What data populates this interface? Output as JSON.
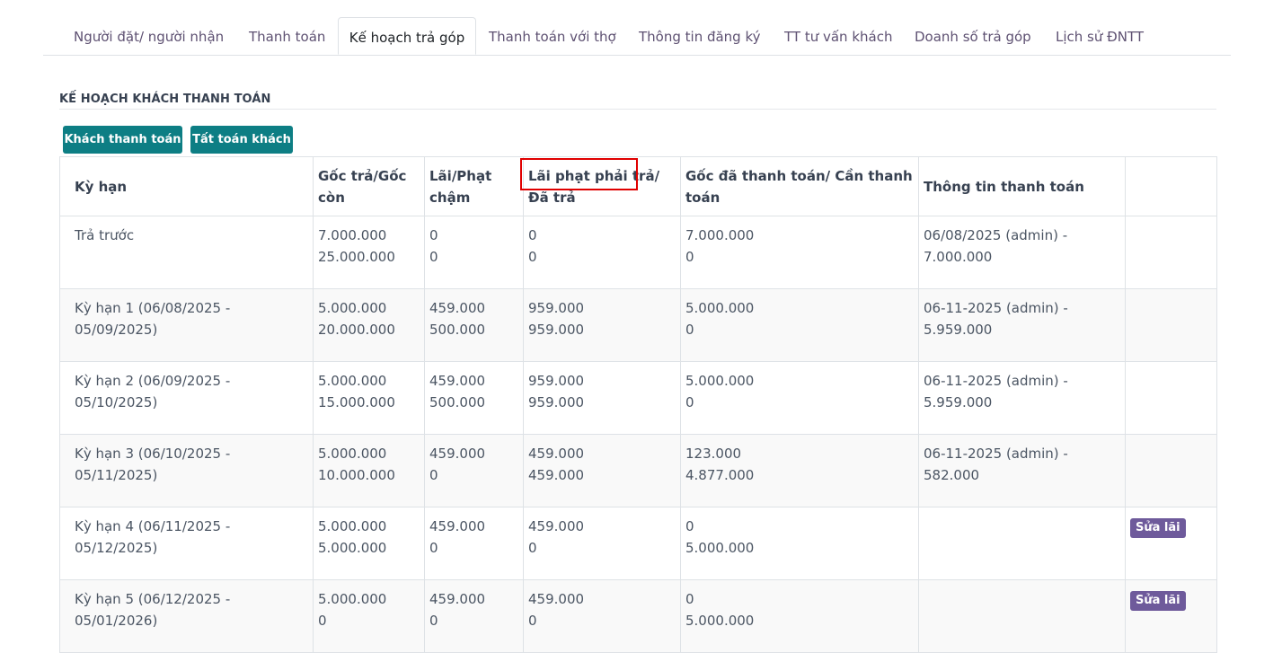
{
  "tabs": [
    {
      "label": "Người đặt/ người nhận",
      "active": false
    },
    {
      "label": "Thanh toán",
      "active": false
    },
    {
      "label": "Kế hoạch trả góp",
      "active": true
    },
    {
      "label": "Thanh toán với thợ",
      "active": false
    },
    {
      "label": "Thông tin đăng ký",
      "active": false
    },
    {
      "label": "TT tư vấn khách",
      "active": false
    },
    {
      "label": "Doanh số trả góp",
      "active": false
    },
    {
      "label": "Lịch sử ĐNTT",
      "active": false
    }
  ],
  "section": {
    "title": "KẾ HOẠCH KHÁCH THANH TOÁN"
  },
  "buttons": {
    "customer_payment": "Khách thanh toán",
    "settle_customer": "Tất toán khách"
  },
  "table": {
    "headers": {
      "term": "Kỳ hạn",
      "principal": "Gốc trả/Gốc còn",
      "interest": "Lãi/Phạt chậm",
      "penalty": "Lãi phạt phải trả/Đã trả",
      "principal_paid": "Gốc đã thanh toán/ Cần thanh toán",
      "payment_info": "Thông tin thanh toán",
      "actions": ""
    },
    "rows": [
      {
        "term": "Trả trước",
        "principal_paid_amt": "7.000.000",
        "principal_remaining": "25.000.000",
        "interest": "0",
        "late_penalty": "0",
        "penalty_due": "0",
        "penalty_paid": "0",
        "principal_settled": "7.000.000",
        "principal_needed": "0",
        "payment_info": "06/08/2025 (admin) - 7.000.000",
        "action": ""
      },
      {
        "term": "Kỳ hạn 1 (06/08/2025 - 05/09/2025)",
        "principal_paid_amt": "5.000.000",
        "principal_remaining": "20.000.000",
        "interest": "459.000",
        "late_penalty": "500.000",
        "penalty_due": "959.000",
        "penalty_paid": "959.000",
        "principal_settled": "5.000.000",
        "principal_needed": "0",
        "payment_info": "06-11-2025 (admin) - 5.959.000",
        "action": ""
      },
      {
        "term": "Kỳ hạn 2 (06/09/2025 - 05/10/2025)",
        "principal_paid_amt": "5.000.000",
        "principal_remaining": "15.000.000",
        "interest": "459.000",
        "late_penalty": "500.000",
        "penalty_due": "959.000",
        "penalty_paid": "959.000",
        "principal_settled": "5.000.000",
        "principal_needed": "0",
        "payment_info": "06-11-2025 (admin) - 5.959.000",
        "action": ""
      },
      {
        "term": "Kỳ hạn 3 (06/10/2025 - 05/11/2025)",
        "principal_paid_amt": "5.000.000",
        "principal_remaining": "10.000.000",
        "interest": "459.000",
        "late_penalty": "0",
        "penalty_due": "459.000",
        "penalty_paid": "459.000",
        "principal_settled": "123.000",
        "principal_needed": "4.877.000",
        "payment_info": "06-11-2025 (admin) - 582.000",
        "action": ""
      },
      {
        "term": "Kỳ hạn 4 (06/11/2025 - 05/12/2025)",
        "principal_paid_amt": "5.000.000",
        "principal_remaining": "5.000.000",
        "interest": "459.000",
        "late_penalty": "0",
        "penalty_due": "459.000",
        "penalty_paid": "0",
        "principal_settled": "0",
        "principal_needed": "5.000.000",
        "payment_info": "",
        "action": "Sửa lãi"
      },
      {
        "term": "Kỳ hạn 5 (06/12/2025 - 05/01/2026)",
        "principal_paid_amt": "5.000.000",
        "principal_remaining": "0",
        "interest": "459.000",
        "late_penalty": "0",
        "penalty_due": "459.000",
        "penalty_paid": "0",
        "principal_settled": "0",
        "principal_needed": "5.000.000",
        "payment_info": "",
        "action": "Sửa lãi"
      }
    ]
  },
  "colors": {
    "primary_button": "#0d7e84",
    "badge": "#6e5a9b",
    "highlight": "#e00000",
    "tab_text": "#5e5172"
  }
}
